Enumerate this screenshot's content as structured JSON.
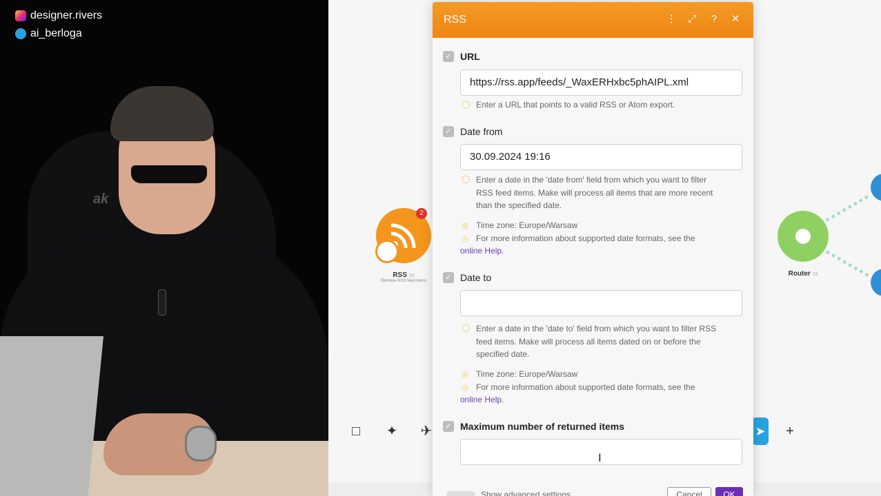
{
  "overlay": {
    "instagram_handle": "designer.rivers",
    "telegram_handle": "ai_berloga",
    "chair_brand": "ak"
  },
  "canvas": {
    "rss_node": {
      "label": "RSS",
      "sublabel": "Retrieve RSS feed items",
      "badge": "2",
      "id": "20"
    },
    "router_node": {
      "label": "Router",
      "id": "16"
    }
  },
  "dialog": {
    "title": "RSS",
    "header_icons": [
      "more-icon",
      "expand-icon",
      "help-icon",
      "close-icon"
    ],
    "fields": {
      "url": {
        "label": "URL",
        "value": "https://rss.app/feeds/_WaxERHxbc5phAIPL.xml",
        "hint": "Enter a URL that points to a valid RSS or Atom export."
      },
      "date_from": {
        "label": "Date from",
        "value": "30.09.2024 19:16",
        "hint_line1": "Enter a date in the 'date from' field from which you want to filter",
        "hint_line2": "RSS feed items. Make will process all items that are more recent",
        "hint_line3": "than the specified date.",
        "timezone": "Time zone: Europe/Warsaw",
        "help_line": "For more information about supported date formats, see the",
        "help_link": "online Help."
      },
      "date_to": {
        "label": "Date to",
        "value": "",
        "hint_line1": "Enter a date in the 'date to' field from which you want to filter RSS",
        "hint_line2": "feed items. Make will process all items dated on or before the",
        "hint_line3": "specified date.",
        "timezone": "Time zone: Europe/Warsaw",
        "help_line": "For more information about supported date formats, see the",
        "help_link": "online Help."
      },
      "max_items": {
        "label": "Maximum number of returned items",
        "value": ""
      }
    },
    "footer": {
      "advanced_label": "Show advanced settings",
      "cancel_label": "Cancel",
      "ok_label": "OK"
    }
  },
  "colors": {
    "header_orange": "#f28f1c",
    "ok_purple": "#6b2fb3",
    "router_green": "#8ed162",
    "link_purple": "#6b3fb6"
  }
}
